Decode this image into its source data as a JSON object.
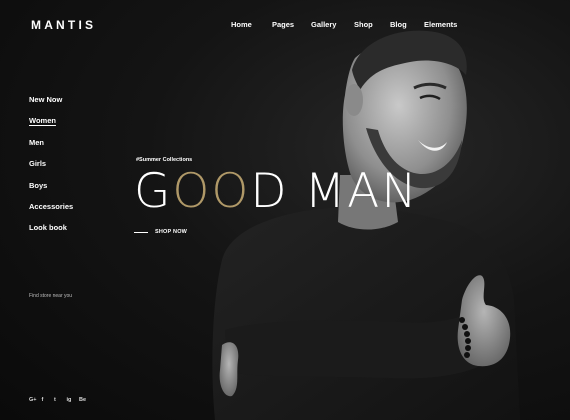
{
  "brand": {
    "logo": "MANTIS"
  },
  "nav": [
    "Home",
    "Pages",
    "Gallery",
    "Shop",
    "Blog",
    "Elements"
  ],
  "side_menu": {
    "items": [
      "New Now",
      "Women",
      "Men",
      "Girls",
      "Boys",
      "Accessories",
      "Look book"
    ],
    "active": "Women"
  },
  "find_store": "Find store near you",
  "hero": {
    "tagline": "#Summer Collections",
    "headline_g": "G",
    "headline_oo": "OO",
    "headline_rest": "D",
    "headline_word2": "MAN",
    "cta": "SHOP NOW"
  },
  "social": [
    "G+",
    "f",
    "t",
    "ig",
    "Be"
  ],
  "colors": {
    "background": "#0d0d0d",
    "accent": "#b09968",
    "text": "#ffffff"
  }
}
